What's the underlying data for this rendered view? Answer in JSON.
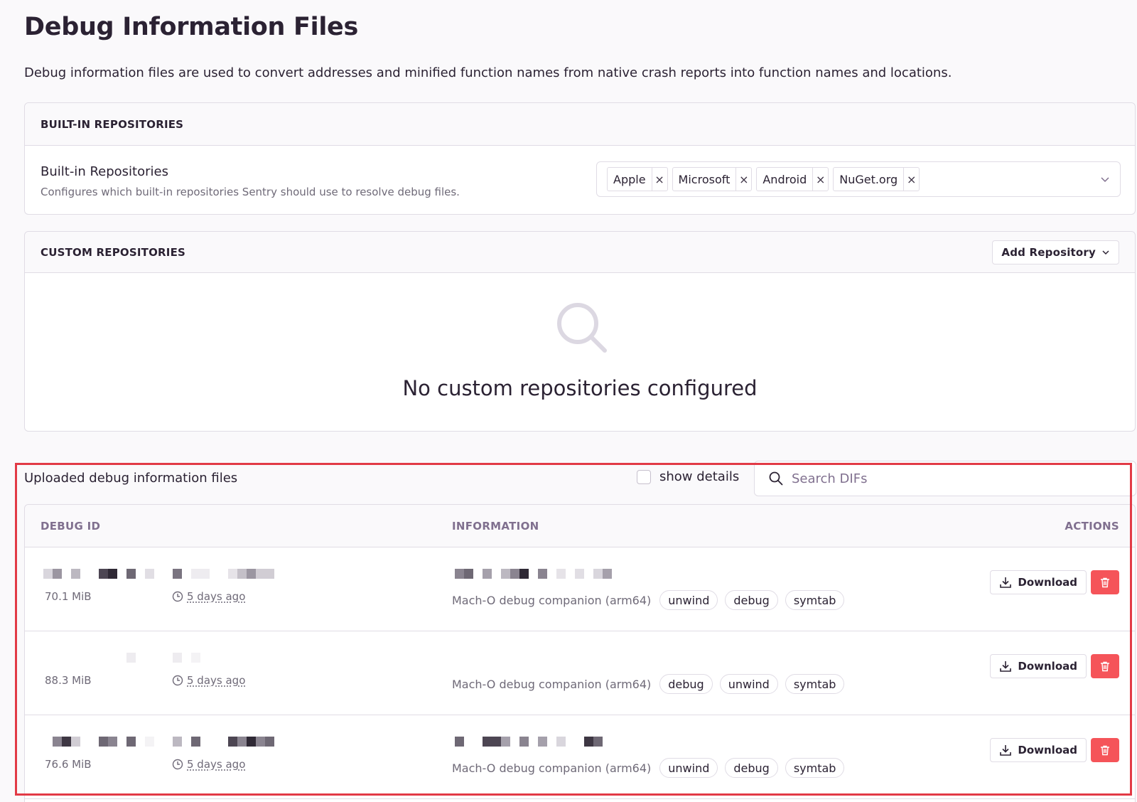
{
  "page": {
    "title": "Debug Information Files",
    "description": "Debug information files are used to convert addresses and minified function names from native crash reports into function names and locations."
  },
  "builtin": {
    "header": "BUILT-IN REPOSITORIES",
    "label": "Built-in Repositories",
    "help": "Configures which built-in repositories Sentry should use to resolve debug files.",
    "chips": [
      "Apple",
      "Microsoft",
      "Android",
      "NuGet.org"
    ],
    "remove_glyph": "×"
  },
  "custom": {
    "header": "CUSTOM REPOSITORIES",
    "add_button": "Add Repository",
    "empty_text": "No custom repositories configured"
  },
  "uploaded": {
    "title": "Uploaded debug information files",
    "show_details": "show details",
    "search_placeholder": "Search DIFs",
    "columns": {
      "debug_id": "DEBUG ID",
      "information": "INFORMATION",
      "actions": "ACTIONS"
    },
    "download_label": "Download",
    "rows": [
      {
        "size": "70.1 MiB",
        "ago": "5 days ago",
        "kind": "Mach-O debug companion (arm64)",
        "tags": [
          "unwind",
          "debug",
          "symtab"
        ]
      },
      {
        "size": "88.3 MiB",
        "ago": "5 days ago",
        "kind": "Mach-O debug companion (arm64)",
        "tags": [
          "debug",
          "unwind",
          "symtab"
        ]
      },
      {
        "size": "76.6 MiB",
        "ago": "5 days ago",
        "kind": "Mach-O debug companion (arm64)",
        "tags": [
          "unwind",
          "debug",
          "symtab"
        ]
      }
    ]
  },
  "icons": {
    "search": "search-icon",
    "chevron": "chevron-down-icon",
    "clock": "clock-icon",
    "download": "download-icon",
    "delete": "trash-icon"
  },
  "colors": {
    "text": "#2b2233",
    "muted": "#6f6a78",
    "border": "#e0dce5",
    "danger": "#f55459",
    "highlight": "#e23a46"
  }
}
